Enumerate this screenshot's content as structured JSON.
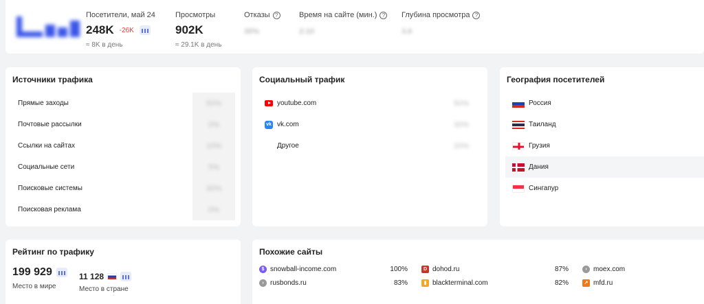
{
  "colors": {
    "accent": "#3a56e8",
    "negative": "#e0403a",
    "youtube": "#ff0000",
    "vk": "#2787f5"
  },
  "stats": {
    "visitors": {
      "label": "Посетители, май 24",
      "value": "248K",
      "delta": "-26K",
      "sub": "≈ 8K в день"
    },
    "views": {
      "label": "Просмотры",
      "value": "902K",
      "sub": "≈ 29.1K в день"
    },
    "bounce": {
      "label": "Отказы",
      "value": "30%"
    },
    "time": {
      "label": "Время на сайте (мин.)",
      "value": "2:10"
    },
    "depth": {
      "label": "Глубина просмотра",
      "value": "3.6"
    }
  },
  "traffic_sources": {
    "title": "Источники трафика",
    "items": [
      {
        "label": "Прямые заходы",
        "value": "50%"
      },
      {
        "label": "Почтовые рассылки",
        "value": "0%"
      },
      {
        "label": "Ссылки на сайтах",
        "value": "10%"
      },
      {
        "label": "Социальные сети",
        "value": "5%"
      },
      {
        "label": "Поисковые системы",
        "value": "30%"
      },
      {
        "label": "Поисковая реклама",
        "value": "0%"
      }
    ]
  },
  "social": {
    "title": "Социальный трафик",
    "items": [
      {
        "label": "youtube.com",
        "icon": "youtube-icon",
        "value": "50%"
      },
      {
        "label": "vk.com",
        "icon": "vk-icon",
        "value": "30%"
      },
      {
        "label": "Другое",
        "icon": "",
        "value": "20%"
      }
    ]
  },
  "geo": {
    "title": "География посетителей",
    "items": [
      {
        "label": "Россия",
        "flag": "russia-flag-icon"
      },
      {
        "label": "Таиланд",
        "flag": "thailand-flag-icon"
      },
      {
        "label": "Грузия",
        "flag": "georgia-flag-icon"
      },
      {
        "label": "Дания",
        "flag": "denmark-flag-icon"
      },
      {
        "label": "Сингапур",
        "flag": "singapore-flag-icon"
      }
    ]
  },
  "rating": {
    "title": "Рейтинг по трафику",
    "world_value": "199 929",
    "world_label": "Место в мире",
    "country_value": "11 128",
    "country_label": "Место в стране"
  },
  "similar": {
    "title": "Похожие сайты",
    "items": [
      {
        "name": "snowball-income.com",
        "pct": "100%",
        "icon": "snowball-icon",
        "color": "#7a5cf0"
      },
      {
        "name": "rusbonds.ru",
        "pct": "83%",
        "icon": "rusbonds-icon",
        "color": "#9a9a9a"
      },
      {
        "name": "dohod.ru",
        "pct": "87%",
        "icon": "dohod-icon",
        "color": "#c0392b"
      },
      {
        "name": "blackterminal.com",
        "pct": "82%",
        "icon": "blackterminal-icon",
        "color": "#f5a623"
      },
      {
        "name": "moex.com",
        "pct": "",
        "icon": "moex-icon",
        "color": "#9a9a9a"
      },
      {
        "name": "mfd.ru",
        "pct": "",
        "icon": "mfd-icon",
        "color": "#f07a1a"
      }
    ]
  }
}
